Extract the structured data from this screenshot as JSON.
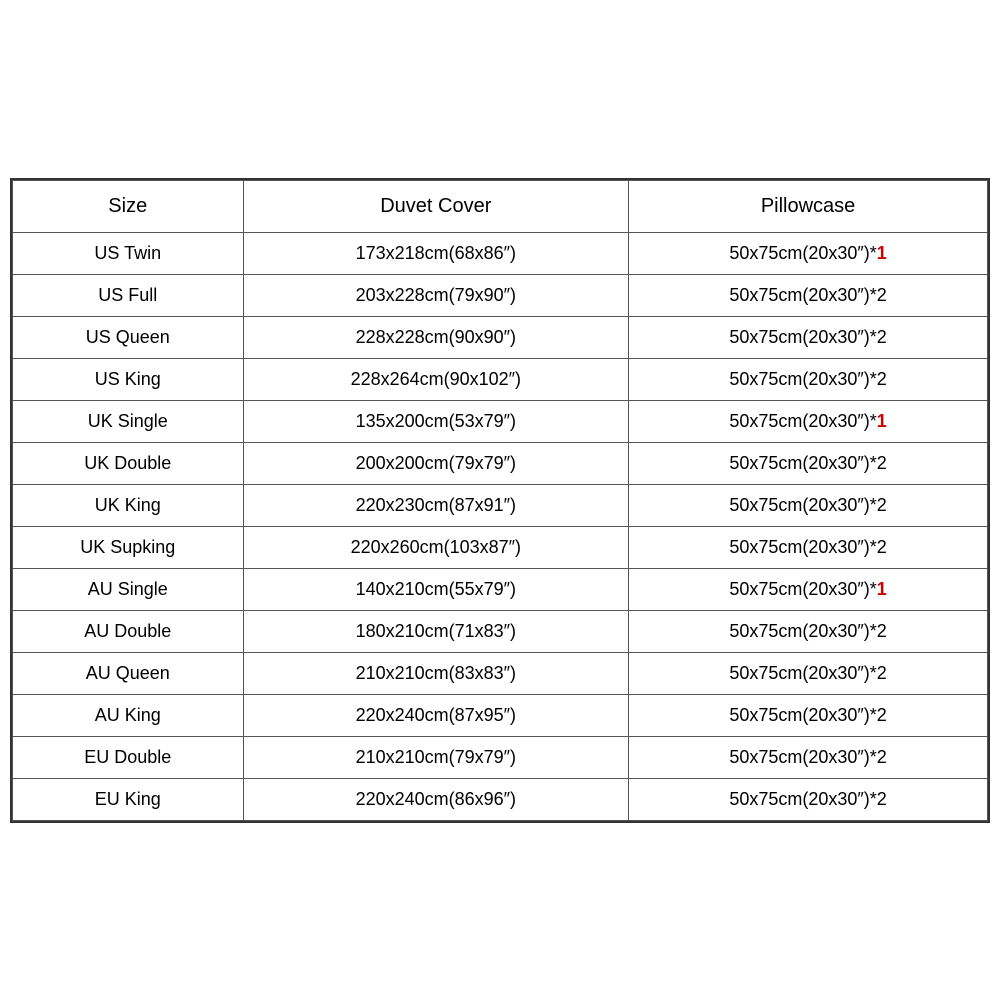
{
  "table": {
    "headers": [
      "Size",
      "Duvet Cover",
      "Pillowcase"
    ],
    "rows": [
      {
        "size": "US Twin",
        "duvet": "173x218cm(68x86″)",
        "pillow_base": "50x75cm(20x30″)*",
        "pillow_count": "1",
        "is_red": true
      },
      {
        "size": "US Full",
        "duvet": "203x228cm(79x90″)",
        "pillow_base": "50x75cm(20x30″)*",
        "pillow_count": "2",
        "is_red": false
      },
      {
        "size": "US Queen",
        "duvet": "228x228cm(90x90″)",
        "pillow_base": "50x75cm(20x30″)*",
        "pillow_count": "2",
        "is_red": false
      },
      {
        "size": "US King",
        "duvet": "228x264cm(90x102″)",
        "pillow_base": "50x75cm(20x30″)*",
        "pillow_count": "2",
        "is_red": false
      },
      {
        "size": "UK Single",
        "duvet": "135x200cm(53x79″)",
        "pillow_base": "50x75cm(20x30″)*",
        "pillow_count": "1",
        "is_red": true
      },
      {
        "size": "UK Double",
        "duvet": "200x200cm(79x79″)",
        "pillow_base": "50x75cm(20x30″)*",
        "pillow_count": "2",
        "is_red": false
      },
      {
        "size": "UK King",
        "duvet": "220x230cm(87x91″)",
        "pillow_base": "50x75cm(20x30″)*",
        "pillow_count": "2",
        "is_red": false
      },
      {
        "size": "UK Supking",
        "duvet": "220x260cm(103x87″)",
        "pillow_base": "50x75cm(20x30″)*",
        "pillow_count": "2",
        "is_red": false
      },
      {
        "size": "AU Single",
        "duvet": "140x210cm(55x79″)",
        "pillow_base": "50x75cm(20x30″)*",
        "pillow_count": "1",
        "is_red": true
      },
      {
        "size": "AU Double",
        "duvet": "180x210cm(71x83″)",
        "pillow_base": "50x75cm(20x30″)*",
        "pillow_count": "2",
        "is_red": false
      },
      {
        "size": "AU Queen",
        "duvet": "210x210cm(83x83″)",
        "pillow_base": "50x75cm(20x30″)*",
        "pillow_count": "2",
        "is_red": false
      },
      {
        "size": "AU King",
        "duvet": "220x240cm(87x95″)",
        "pillow_base": "50x75cm(20x30″)*",
        "pillow_count": "2",
        "is_red": false
      },
      {
        "size": "EU Double",
        "duvet": "210x210cm(79x79″)",
        "pillow_base": "50x75cm(20x30″)*",
        "pillow_count": "2",
        "is_red": false
      },
      {
        "size": "EU King",
        "duvet": "220x240cm(86x96″)",
        "pillow_base": "50x75cm(20x30″)*",
        "pillow_count": "2",
        "is_red": false
      }
    ]
  }
}
